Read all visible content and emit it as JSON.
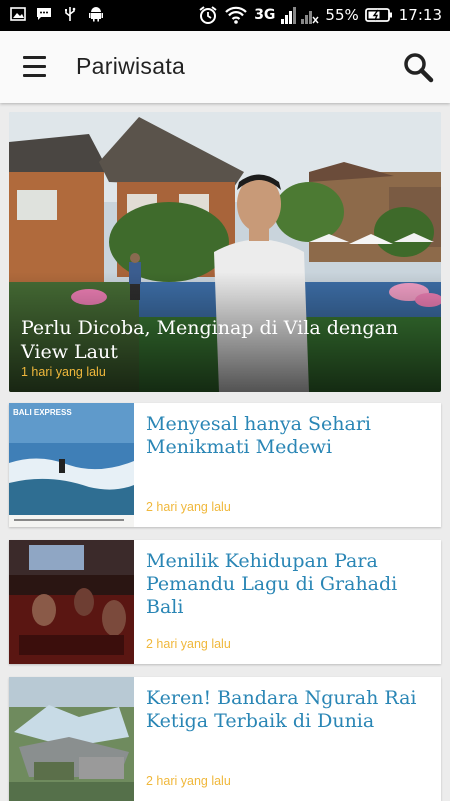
{
  "status_bar": {
    "battery_percent": "55%",
    "time": "17:13",
    "network": "3G",
    "icons": [
      "image-icon",
      "message-icon",
      "usb-icon",
      "android-icon",
      "alarm-icon",
      "wifi-icon",
      "signal-icon",
      "battery-icon"
    ]
  },
  "app_bar": {
    "title": "Pariwisata",
    "menu_icon": "hamburger-menu-icon",
    "search_icon": "search-icon"
  },
  "hero": {
    "title": "Perlu Dicoba, Menginap di Vila dengan View Laut",
    "time": "1 hari yang lalu"
  },
  "articles": [
    {
      "title": "Menyesal hanya Sehari Menikmati Medewi",
      "time": "2 hari yang lalu",
      "thumb_label": "BALI EXPRESS"
    },
    {
      "title": "Menilik Kehidupan Para Pemandu Lagu di Grahadi Bali",
      "time": "2 hari yang lalu"
    },
    {
      "title": "Keren! Bandara Ngurah Rai Ketiga Terbaik di Dunia",
      "time": "2 hari yang lalu"
    }
  ],
  "colors": {
    "accent_blue": "#2a86b5",
    "time_orange": "#f0b83c",
    "appbar": "#fafafa"
  }
}
